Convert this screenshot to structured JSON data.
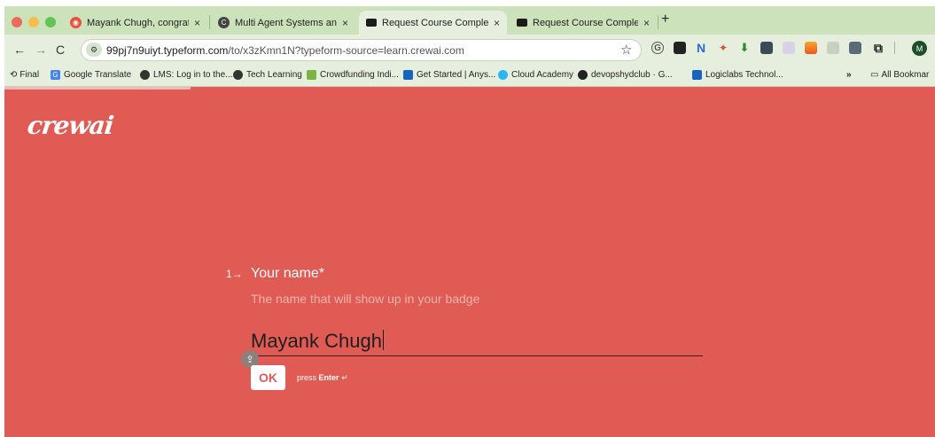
{
  "browser": {
    "tabs": [
      {
        "title": "Mayank Chugh, congratulatio",
        "close": "×",
        "favicon_color": "#e8533f"
      },
      {
        "title": "Multi Agent Systems and how",
        "close": "×",
        "favicon_color": "#444444"
      },
      {
        "title": "Request Course Completion",
        "close": "×",
        "favicon_color": "#1b1b1b"
      },
      {
        "title": "Request Course Completion",
        "close": "×",
        "favicon_color": "#1b1b1b"
      }
    ],
    "new_tab": "+",
    "url_host": "99pj7n9uiyt.typeform.com",
    "url_path": "/to/x3zKmn1N?typeform-source=learn.crewai.com",
    "profile_initial": "M",
    "bookmarks": [
      {
        "label": "Final",
        "icon_color": "#666666"
      },
      {
        "label": "Google Translate",
        "icon_color": "#4285f4"
      },
      {
        "label": "LMS: Log in to the...",
        "icon_color": "#333333"
      },
      {
        "label": "Tech Learning",
        "icon_color": "#333333"
      },
      {
        "label": "Crowdfunding Indi...",
        "icon_color": "#7cb342"
      },
      {
        "label": "Get Started | Anys...",
        "icon_color": "#1565c0"
      },
      {
        "label": "Cloud Academy",
        "icon_color": "#29b6f6"
      },
      {
        "label": "devopshydclub · G...",
        "icon_color": "#222222"
      },
      {
        "label": "Logiclabs Technol...",
        "icon_color": "#1565c0"
      }
    ],
    "more_bookmarks": "»",
    "all_bookmarks": "All Bookmar"
  },
  "form": {
    "logo": "crewai",
    "question_number": "1",
    "question_arrow": "→",
    "question_title": "Your name*",
    "question_description": "The name that will show up in your badge",
    "answer_value": "Mayank Chugh",
    "ok_label": "OK",
    "hint_press": "press",
    "hint_key": "Enter",
    "hint_symbol": "↵"
  },
  "colors": {
    "form_background": "#e05b53",
    "browser_chrome": "#cbe2bb",
    "toolbar": "#e6efde"
  }
}
